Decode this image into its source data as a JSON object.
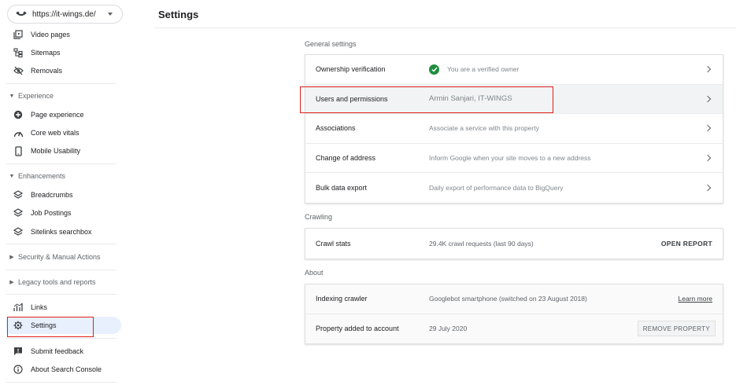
{
  "property": {
    "url": "https://it-wings.de/"
  },
  "sidebar": {
    "items_top": [
      {
        "label": "Video pages",
        "icon": "video-pages-icon"
      },
      {
        "label": "Sitemaps",
        "icon": "sitemap-icon"
      },
      {
        "label": "Removals",
        "icon": "removals-icon"
      }
    ],
    "experience": {
      "label": "Experience",
      "items": [
        {
          "label": "Page experience",
          "icon": "page-experience-icon"
        },
        {
          "label": "Core web vitals",
          "icon": "speed-icon"
        },
        {
          "label": "Mobile Usability",
          "icon": "mobile-icon"
        }
      ]
    },
    "enhancements": {
      "label": "Enhancements",
      "items": [
        {
          "label": "Breadcrumbs",
          "icon": "layers-icon"
        },
        {
          "label": "Job Postings",
          "icon": "layers-icon"
        },
        {
          "label": "Sitelinks searchbox",
          "icon": "layers-icon"
        }
      ]
    },
    "security": {
      "label": "Security & Manual Actions"
    },
    "legacy": {
      "label": "Legacy tools and reports"
    },
    "links": {
      "label": "Links",
      "icon": "links-icon"
    },
    "settings": {
      "label": "Settings",
      "icon": "gear-icon"
    },
    "feedback": {
      "label": "Submit feedback",
      "icon": "feedback-icon"
    },
    "about": {
      "label": "About Search Console",
      "icon": "info-icon"
    }
  },
  "page": {
    "title": "Settings"
  },
  "general": {
    "label": "General settings",
    "rows": [
      {
        "label": "Ownership verification",
        "value": "You are a verified owner"
      },
      {
        "label": "Users and permissions",
        "value": "Armin Sanjari, IT-WINGS"
      },
      {
        "label": "Associations",
        "value": "Associate a service with this property"
      },
      {
        "label": "Change of address",
        "value": "Inform Google when your site moves to a new address"
      },
      {
        "label": "Bulk data export",
        "value": "Daily export of performance data to BigQuery"
      }
    ]
  },
  "crawling": {
    "label": "Crawling",
    "row": {
      "label": "Crawl stats",
      "value": "29.4K crawl requests (last 90 days)",
      "action": "OPEN REPORT"
    }
  },
  "about": {
    "label": "About",
    "rows": [
      {
        "label": "Indexing crawler",
        "value": "Googlebot smartphone (switched on 23 August 2018)",
        "action": "Learn more"
      },
      {
        "label": "Property added to account",
        "value": "29 July 2020",
        "action": "REMOVE PROPERTY"
      }
    ]
  },
  "colors": {
    "accent_bg": "#e8f0fe",
    "verified": "#1e8e3e",
    "highlight": "#e0201b"
  }
}
